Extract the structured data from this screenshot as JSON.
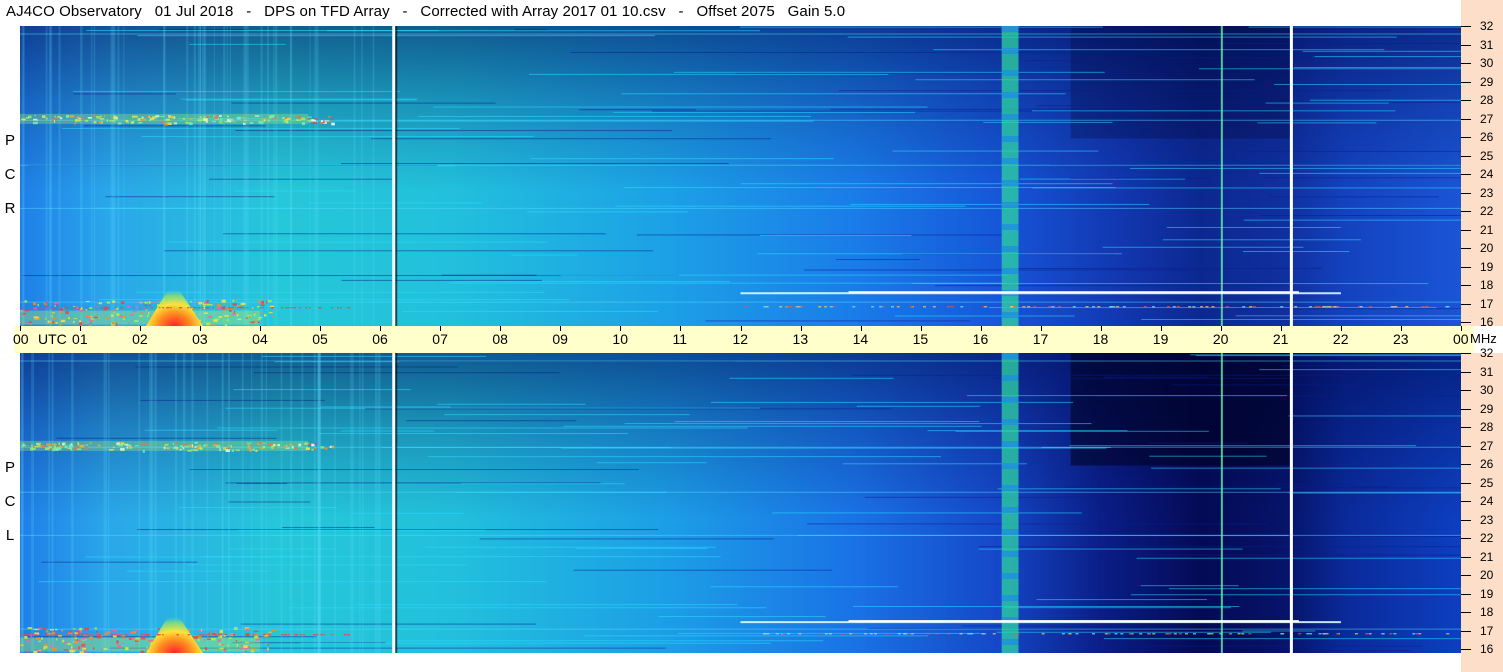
{
  "title": {
    "station": "AJ4CO Observatory",
    "date": "01 Jul 2018",
    "system": "DPS on TFD Array",
    "correction": "Corrected with Array 2017 01 10.csv",
    "offset": "Offset 2075",
    "gain": "Gain 5.0",
    "separator": "-"
  },
  "panels": {
    "top": {
      "label_letters": [
        "P",
        "C",
        "R"
      ]
    },
    "bottom": {
      "label_letters": [
        "P",
        "C",
        "L"
      ]
    }
  },
  "colors": {
    "background": "#ffffff",
    "time_axis_bg": "#ffffcc",
    "freq_axis_bg": "#fddfc9",
    "divider": "#ffffff"
  },
  "chart_data": {
    "type": "heatmap",
    "x_unit": "UTC",
    "y_unit": "MHz",
    "x_ticks": [
      "00",
      "01",
      "02",
      "03",
      "04",
      "05",
      "06",
      "07",
      "08",
      "09",
      "10",
      "11",
      "12",
      "13",
      "14",
      "15",
      "16",
      "17",
      "18",
      "19",
      "20",
      "21",
      "22",
      "23",
      "00"
    ],
    "x_range_hours": [
      0,
      24
    ],
    "y_ticks": [
      32,
      31,
      30,
      29,
      28,
      27,
      26,
      25,
      24,
      23,
      22,
      21,
      20,
      19,
      18,
      17,
      16
    ],
    "y_range_mhz": [
      16,
      32
    ],
    "colormap": "jet",
    "white_gap_hours": [
      6.2,
      21.15
    ],
    "interference_band_hour": 16.5,
    "vertical_bright_line_hour": 20.0,
    "panels": [
      "RCP",
      "LCP"
    ]
  }
}
